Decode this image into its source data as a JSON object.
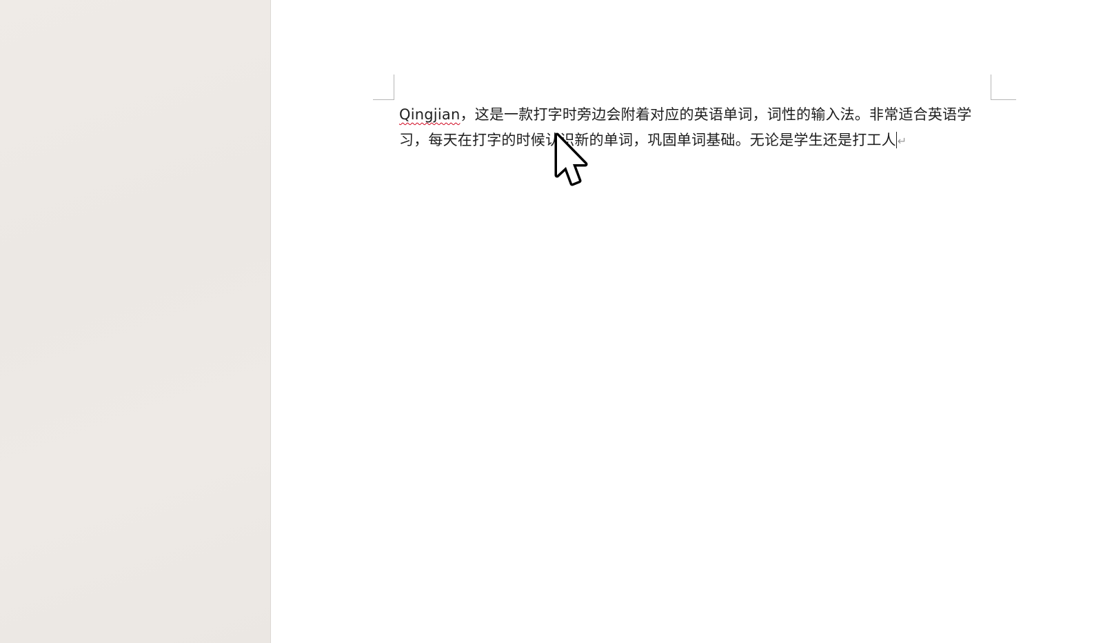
{
  "document": {
    "misspelled_word": "Qingjian",
    "paragraph_rest": "，这是一款打字时旁边会附着对应的英语单词，词性的输入法。非常适合英语学习，每天在打字的时候认识新的单词，巩固单词基础。无论是学生还是打工人",
    "paragraph_mark": "↵"
  },
  "colors": {
    "sidebar_background": "#ede9e5",
    "page_background": "#ffffff",
    "text": "#1e1e1e",
    "spellcheck_underline": "#d0021b",
    "crop_marks": "#b5b5b5"
  },
  "icons": {
    "mouse_pointer": "arrow-cursor-icon",
    "paragraph_mark": "return-icon"
  }
}
